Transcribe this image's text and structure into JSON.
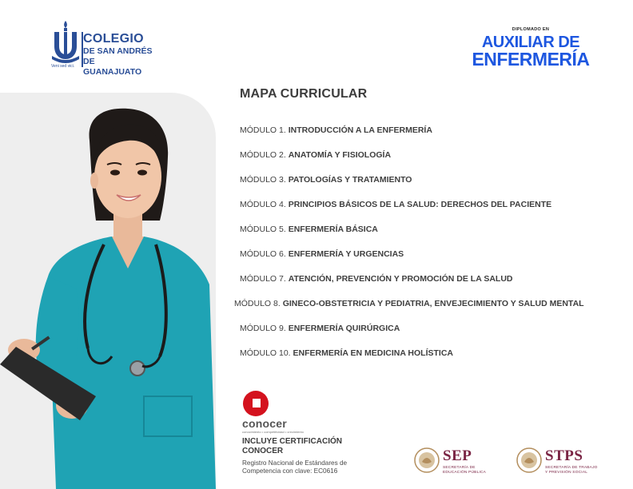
{
  "header": {
    "college": {
      "line1": "COLEGIO",
      "line2": "DE SAN ANDRÉS",
      "line3": "DE GUANAJUATO",
      "motto": "Veni sed vici.",
      "color": "#2a4e97"
    },
    "diplomado": {
      "pre": "DIPLOMADO EN",
      "line1": "AUXILIAR DE",
      "line2": "ENFERMERÍA",
      "color": "#1e57e0"
    }
  },
  "curriculum": {
    "title": "MAPA CURRICULAR",
    "modules": [
      {
        "num": "MÓDULO 1.",
        "name": "INTRODUCCIÓN A LA ENFERMERÍA"
      },
      {
        "num": "MÓDULO 2.",
        "name": "ANATOMÍA Y FISIOLOGÍA"
      },
      {
        "num": "MÓDULO 3.",
        "name": "PATOLOGÍAS Y TRATAMIENTO"
      },
      {
        "num": "MÓDULO 4.",
        "name": "PRINCIPIOS BÁSICOS DE LA SALUD: DERECHOS DEL PACIENTE"
      },
      {
        "num": "MÓDULO 5.",
        "name": "ENFERMERÍA BÁSICA"
      },
      {
        "num": "MÓDULO 6.",
        "name": "ENFERMERÍA Y URGENCIAS"
      },
      {
        "num": "MÓDULO 7.",
        "name": "ATENCIÓN, PREVENCIÓN Y PROMOCIÓN DE LA SALUD"
      },
      {
        "num": "MÓDULO 8.",
        "name": "GINECO-OBSTETRICIA Y PEDIATRIA, ENVEJECIMIENTO Y SALUD MENTAL"
      },
      {
        "num": "MÓDULO 9.",
        "name": "ENFERMERÍA QUIRÚRGICA"
      },
      {
        "num": "MÓDULO 10.",
        "name": "ENFERMERÍA EN MEDICINA HOLÍSTICA"
      }
    ]
  },
  "certification": {
    "brand": "conocer",
    "tagline": "conocimiento • competitividad • crecimiento",
    "title_line1": "INCLUYE CERTIFICACIÓN",
    "title_line2": "CONOCER",
    "desc_line1": "Registro Nacional de Estándares de",
    "desc_line2": "Competencia con clave: EC0616",
    "brand_color": "#d4121e"
  },
  "government": {
    "sep": {
      "abbr": "SEP",
      "sub1": "SECRETARÍA DE",
      "sub2": "EDUCACIÓN PÚBLICA"
    },
    "stps": {
      "abbr": "STPS",
      "sub1": "SECRETARÍA DE TRABAJO",
      "sub2": "Y PREVISIÓN SOCIAL"
    },
    "color": "#7a2444"
  }
}
